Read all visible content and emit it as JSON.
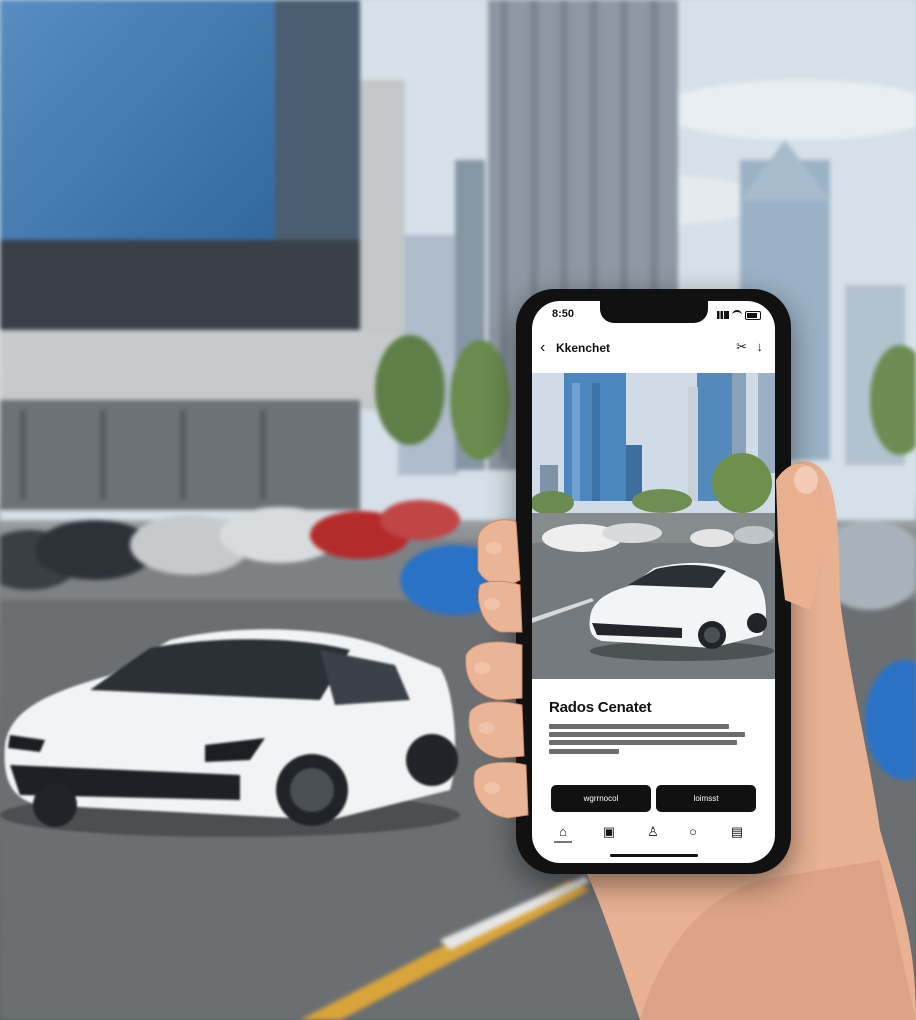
{
  "phone": {
    "status_time": "8:50",
    "nav_title": "Kkenchet",
    "back_glyph": "‹",
    "action1_glyph": "✂",
    "action2_glyph": "↓",
    "card_title": "Rados Cenatet",
    "button_primary": "wgrrnocol",
    "button_secondary": "loimsst",
    "tabs": [
      "tab-1",
      "tab-2",
      "tab-3",
      "tab-4",
      "tab-5"
    ]
  },
  "icons": {
    "back": "chevron-left-icon",
    "action1": "share-icon",
    "action2": "download-icon",
    "tab_icons": [
      "store-icon",
      "gallery-icon",
      "person-icon",
      "search-icon",
      "calendar-icon"
    ]
  },
  "colors": {
    "phone_frame": "#111111",
    "button_bg": "#111111",
    "car_white": "#f2f3f4",
    "car_blue": "#2a72c6",
    "car_red": "#b52a2a"
  }
}
